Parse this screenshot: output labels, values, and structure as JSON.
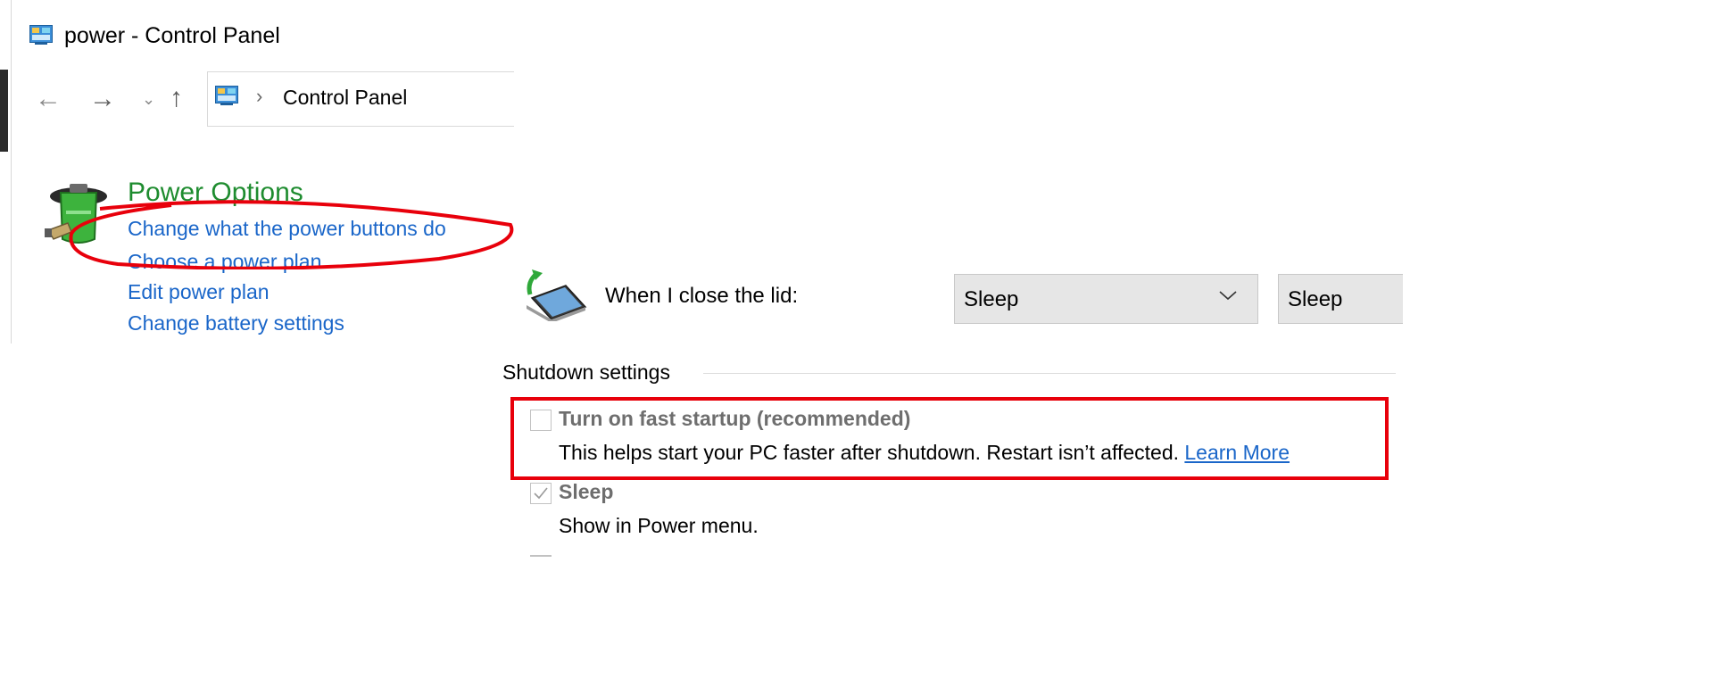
{
  "control_panel": {
    "window_title": "power - Control Panel",
    "nav": {
      "back_glyph": "←",
      "forward_glyph": "→",
      "recent_glyph": "⌄",
      "up_glyph": "↑"
    },
    "address": {
      "separator": "›",
      "location": "Control Panel"
    },
    "result": {
      "title": "Power Options",
      "links": [
        "Change what the power buttons do",
        "Choose a power plan",
        "Edit power plan",
        "Change battery settings"
      ]
    },
    "highlight_color": "#e8000b",
    "link_color": "#1a66c9",
    "title_color": "#1e8c2f"
  },
  "system_settings": {
    "lid": {
      "label": "When I close the lid:",
      "on_battery": "Sleep",
      "plugged_in": "Sleep"
    },
    "shutdown": {
      "heading": "Shutdown settings",
      "fast_startup": {
        "label": "Turn on fast startup (recommended)",
        "description": "This helps start your PC faster after shutdown. Restart isn’t affected.",
        "learn_more": "Learn More",
        "checked": false
      },
      "sleep": {
        "label": "Sleep",
        "description": "Show in Power menu.",
        "checked": true
      }
    }
  }
}
